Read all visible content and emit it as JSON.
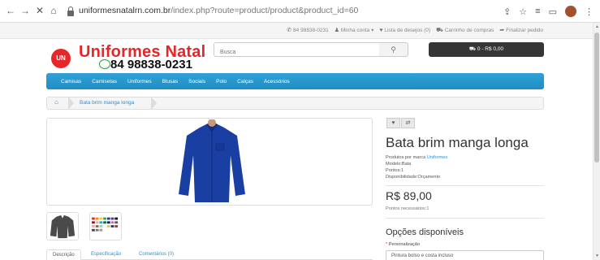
{
  "browser": {
    "url_host": "uniformesnatalrn.com.br",
    "url_path": "/index.php?route=product/product&product_id=60"
  },
  "toplinks": {
    "phone": "84 98838-0231",
    "account": "Minha conta",
    "wishlist": "Lista de desejos (0)",
    "cart": "Carrinho de compras",
    "checkout": "Finalizar pedido"
  },
  "header": {
    "logo_badge": "UN",
    "logo_title": "Uniformes Natal",
    "logo_phone": "84 98838-0231",
    "search_placeholder": "Busca",
    "cart_button": "0 - R$ 0,00"
  },
  "menu": [
    "Camisas",
    "Camisetas",
    "Uniformes",
    "Blusas",
    "Sociais",
    "Polo",
    "Calças",
    "Acessórios"
  ],
  "breadcrumb": {
    "current": "Bata brim manga longa"
  },
  "product": {
    "title": "Bata brim manga longa",
    "brand_label": "Produtos por marca",
    "brand": "Uniformes",
    "model": "Modelo:Bata",
    "points": "Pontos:1",
    "availability": "Disponibilidade:Orçamento",
    "price": "R$ 89,00",
    "points_needed": "Pontos necessários:1",
    "options_title": "Opções disponíveis",
    "option_label": "Personalização",
    "option_value": "Pintura bolso e costa incluso"
  },
  "tabs": [
    "Descrição",
    "Especificação",
    "Comentários (0)"
  ],
  "colors": {
    "brand_red": "#e7262a",
    "menu_blue": "#2fa1d6",
    "link_blue": "#2b8fd3",
    "shirt_blue": "#1a3fa3"
  }
}
